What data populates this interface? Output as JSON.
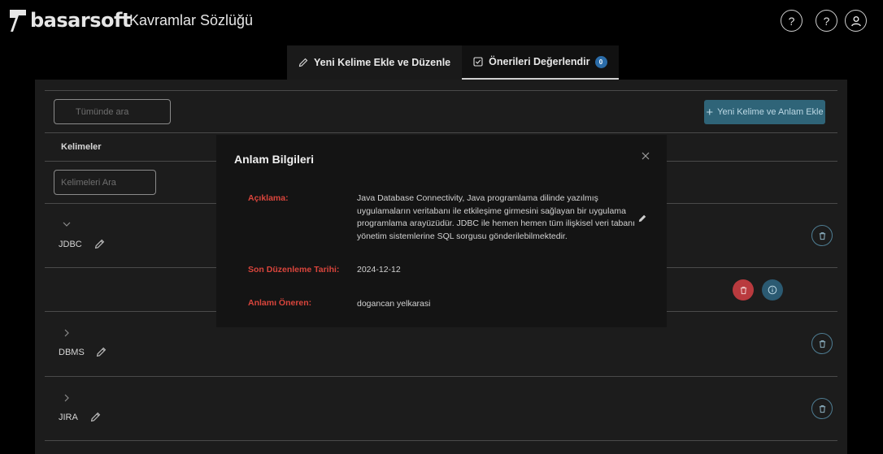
{
  "header": {
    "brand": "basarsoft",
    "title": "Kavramlar Sözlüğü",
    "buttons": [
      {
        "icon": "help-icon",
        "glyph": "?"
      },
      {
        "icon": "help-icon",
        "glyph": "?"
      },
      {
        "icon": "user-icon"
      }
    ]
  },
  "tabs": [
    {
      "label": "Yeni Kelime Ekle ve Düzenle",
      "icon": "pencil-icon",
      "active": false
    },
    {
      "label": "Önerileri Değerlendir",
      "icon": "checkbox-icon",
      "active": true,
      "badge": "0"
    }
  ],
  "toolbar": {
    "search_placeholder": "Tümünde ara",
    "add_button_label": "Yeni Kelime ve Anlam Ekle"
  },
  "table": {
    "column_header": "Kelimeler",
    "filter_placeholder": "Kelimeleri Ara",
    "rows": [
      {
        "word": "JDBC",
        "expanded": true
      },
      {
        "word": "DBMS",
        "expanded": false
      },
      {
        "word": "JIRA",
        "expanded": false
      }
    ]
  },
  "modal": {
    "title": "Anlam Bilgileri",
    "fields": [
      {
        "label": "Açıklama:",
        "value_lines": [
          "Java Database Connectivity, Java programlama dilinde yazılmış",
          "uygulamaların veritabanı ile etkileşime girmesini sağlayan bir uygulama",
          "programlama arayüzüdür. JDBC ile hemen hemen tüm ilişkisel veri tabanı",
          "yönetim sistemlerine SQL sorgusu gönderilebilmektedir."
        ]
      },
      {
        "label": "Son Düzenleme Tarihi:",
        "value": "2024-12-12"
      },
      {
        "label": "Anlamı Öneren:",
        "value": "dogancan yelkarasi"
      }
    ]
  },
  "colors": {
    "accent_red": "#d9453c",
    "add_button_bg": "#2f6478",
    "badge_blue": "#2b6ca8",
    "delete_red": "#b93a3e"
  }
}
